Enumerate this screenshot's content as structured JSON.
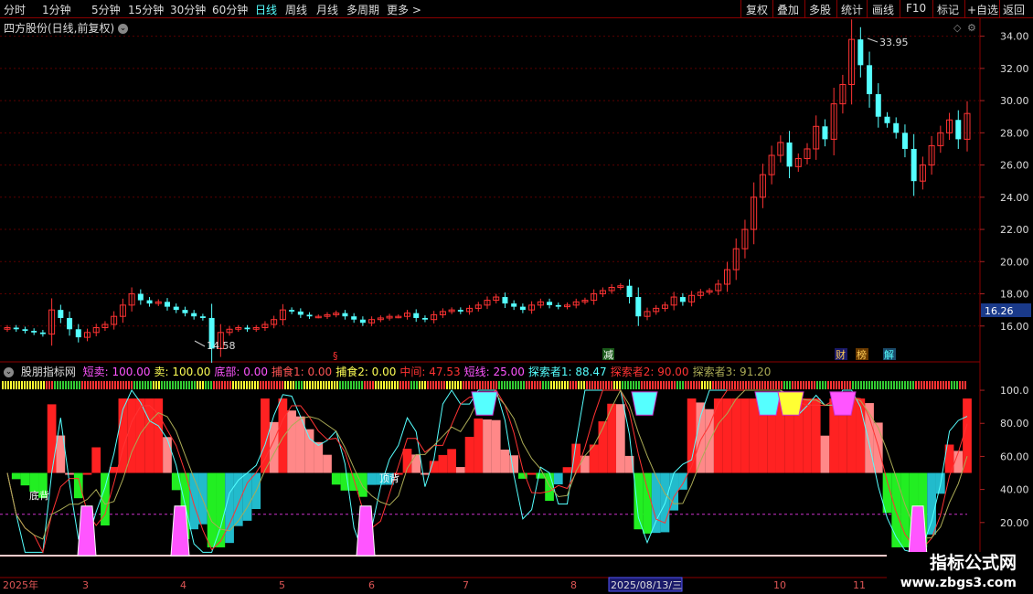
{
  "toolbar": {
    "periods": [
      "分时",
      "1分钟",
      "5分钟",
      "15分钟",
      "30分钟",
      "60分钟",
      "日线",
      "周线",
      "月线",
      "多周期",
      "更多 >"
    ],
    "active_period": "日线",
    "actions": [
      "复权",
      "叠加",
      "多股",
      "统计",
      "画线",
      "F10",
      "标记",
      "+自选",
      "返回"
    ]
  },
  "main_chart": {
    "title": "四方股份(日线,前复权)",
    "price_ticks": [
      "34.00",
      "32.00",
      "30.00",
      "28.00",
      "26.00",
      "24.00",
      "22.00",
      "20.00",
      "18.00",
      "16.00"
    ],
    "current_price": "16.26",
    "high_label": "33.95",
    "low_label": "14.58",
    "event_marks": [
      "减",
      "财",
      "榜",
      "解"
    ]
  },
  "indicator": {
    "name": "股朋指标网",
    "fields": [
      {
        "label": "短卖: 100.00",
        "color": "#ff55ff"
      },
      {
        "label": "卖: 100.00",
        "color": "#ffff55"
      },
      {
        "label": "底部: 0.00",
        "color": "#ff55ff"
      },
      {
        "label": "捕食1: 0.00",
        "color": "#ff5555"
      },
      {
        "label": "捕食2: 0.00",
        "color": "#ffff55"
      },
      {
        "label": "中间: 47.53",
        "color": "#ff3333"
      },
      {
        "label": "短线: 25.00",
        "color": "#ff55ff"
      },
      {
        "label": "探索者1: 88.47",
        "color": "#55ffff"
      },
      {
        "label": "探索者2: 90.00",
        "color": "#ff3333"
      },
      {
        "label": "探索者3: 91.20",
        "color": "#aaaa55"
      }
    ],
    "ticks": [
      "100.0",
      "80.00",
      "60.00",
      "40.00",
      "20.00"
    ],
    "labels": [
      "底背",
      "顶背"
    ]
  },
  "time_axis": {
    "labels": [
      "2025年",
      "3",
      "4",
      "5",
      "6",
      "7",
      "8",
      "2025/08/13/三",
      "10",
      "11"
    ]
  },
  "watermark": {
    "line1": "指标公式网",
    "line2": "www.zbgs3.com"
  },
  "chart_data": {
    "type": "candlestick",
    "price_ylim": [
      14,
      35
    ],
    "indicator_ylim": [
      0,
      105
    ],
    "close": [
      15.9,
      15.8,
      15.7,
      15.6,
      15.5,
      17.0,
      16.5,
      15.8,
      15.3,
      15.6,
      15.9,
      16.1,
      16.6,
      17.3,
      18.0,
      17.6,
      17.4,
      17.5,
      17.2,
      17.0,
      16.8,
      16.6,
      16.5,
      14.6,
      15.6,
      15.8,
      15.9,
      15.8,
      15.9,
      16.1,
      16.4,
      17.0,
      16.9,
      16.7,
      16.6,
      16.6,
      16.7,
      16.8,
      16.6,
      16.4,
      16.2,
      16.4,
      16.5,
      16.6,
      16.6,
      16.8,
      16.5,
      16.4,
      16.7,
      16.9,
      17.0,
      16.9,
      17.1,
      17.3,
      17.6,
      17.8,
      17.4,
      17.2,
      17.0,
      17.3,
      17.5,
      17.3,
      17.2,
      17.3,
      17.5,
      17.6,
      18.0,
      18.2,
      18.4,
      18.5,
      17.8,
      16.6,
      16.9,
      17.1,
      17.3,
      17.8,
      17.5,
      17.9,
      18.1,
      18.2,
      18.6,
      19.5,
      20.8,
      22.0,
      24.0,
      25.4,
      26.6,
      27.4,
      25.9,
      26.4,
      27.0,
      28.4,
      27.6,
      29.8,
      31.0,
      33.8,
      32.2,
      30.4,
      29.0,
      28.6,
      28.0,
      27.0,
      25.0,
      26.0,
      27.2,
      28.0,
      28.8,
      27.6,
      29.2
    ]
  }
}
